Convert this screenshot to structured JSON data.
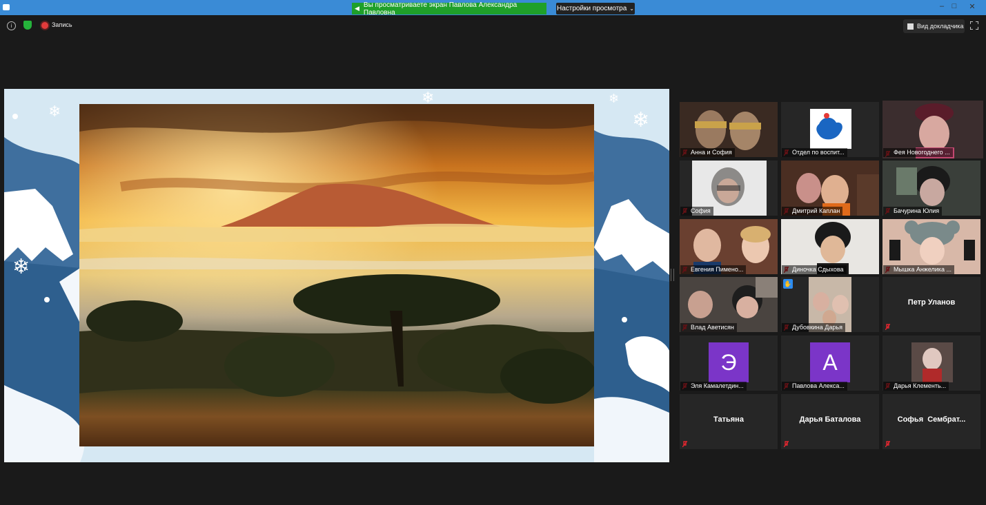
{
  "window": {
    "share_banner": "Вы просматриваете экран Павлова Александра Павловна",
    "view_settings": "Настройки просмотра",
    "controls": {
      "minimize": "–",
      "maximize": "□",
      "close": "✕"
    }
  },
  "topbar": {
    "recording_label": "Запись",
    "speaker_view": "Вид докладчика",
    "icons": [
      "info-icon",
      "shield-icon",
      "record-icon",
      "grid-icon",
      "fullscreen-icon"
    ]
  },
  "colors": {
    "active_speaker": "#c8d23a",
    "muted": "#e0262f",
    "avatar": "#7b35c8",
    "banner": "#1fa02a",
    "titlebar": "#3a8bd6"
  },
  "participants": [
    {
      "name": "Анна и София"
    },
    {
      "name": "Отдел по воспит..."
    },
    {
      "name": "Фея Новогоднего ..."
    },
    {
      "name": "София"
    },
    {
      "name": "Дмитрий Каплан"
    },
    {
      "name": "Бачурина Юлия"
    },
    {
      "name": "Евгения Пимено..."
    },
    {
      "name": "Диночка Сдыхова"
    },
    {
      "name": "Мышка Анжелика ..."
    },
    {
      "name": "Влад Аветисян"
    },
    {
      "name": "Дубовкина Дарья"
    },
    {
      "name": "Петр Уланов"
    },
    {
      "name": "Эля Камалетдин...",
      "avatar": "Э"
    },
    {
      "name": "Павлова Алекса...",
      "avatar": "А"
    },
    {
      "name": "Дарья Клементь..."
    },
    {
      "name": "Татьяна"
    },
    {
      "name": "Дарья Баталова"
    },
    {
      "name": "Софья  Сембрат..."
    }
  ]
}
